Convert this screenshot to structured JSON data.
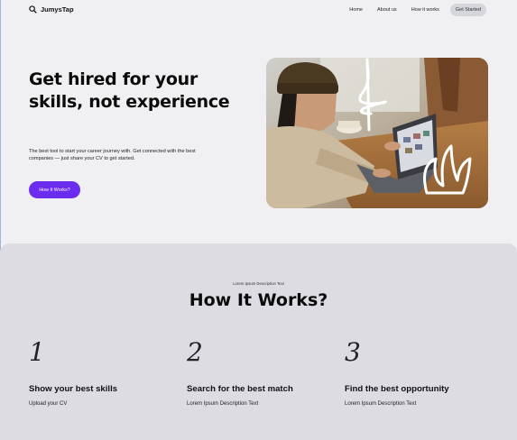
{
  "nav": {
    "logo_text": "JumysTap",
    "links": [
      "Home",
      "About us",
      "How it works"
    ],
    "cta": "Get Started"
  },
  "hero": {
    "title": "Get hired for your skills, not experience",
    "description": "The best tool to start your career journey with. Get connected with the best companies — just share your CV to get started.",
    "button": "How It Works?"
  },
  "how": {
    "kicker": "Lorem Ipsum Description Text",
    "title": "How It Works?",
    "steps": [
      {
        "num": "1",
        "title": "Show your best skills",
        "text": "Upload your CV"
      },
      {
        "num": "2",
        "title": "Search for the best match",
        "text": "Lorem Ipsum Description Text"
      },
      {
        "num": "3",
        "title": "Find the best opportunity",
        "text": "Lorem Ipsum Description Text"
      }
    ]
  },
  "colors": {
    "page_bg": "#f0f0f2",
    "section_bg": "#dedce3",
    "accent": "#6b2cf0",
    "nav_cta_bg": "#d5d6dc"
  },
  "icons": {
    "logo": "magnifier-icon"
  }
}
